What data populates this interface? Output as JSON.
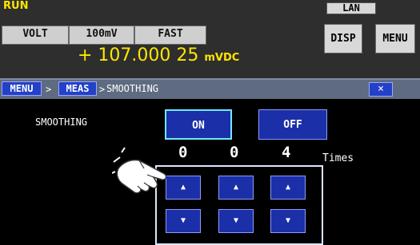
{
  "status": {
    "run": "RUN",
    "lan": "LAN"
  },
  "settings": [
    "VOLT",
    "100mV",
    "FAST"
  ],
  "buttons": {
    "disp": "DISP",
    "menu": "MENU"
  },
  "reading": {
    "value": "+ 107.000 25",
    "unit": "mVDC"
  },
  "breadcrumb": {
    "menu": "MENU",
    "meas": "MEAS",
    "sep": ">",
    "current": "SMOOTHING",
    "close": "×"
  },
  "smoothing": {
    "label": "SMOOTHING",
    "on": "ON",
    "off": "OFF",
    "digits": [
      "0",
      "0",
      "4"
    ],
    "unit": "Times",
    "up": "▲",
    "down": "▼"
  }
}
